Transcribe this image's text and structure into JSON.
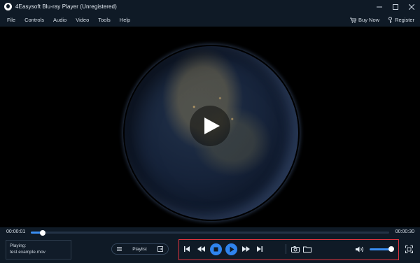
{
  "window": {
    "title": "4Easysoft Blu-ray Player (Unregistered)"
  },
  "menu": {
    "items": [
      {
        "label": "File"
      },
      {
        "label": "Controls"
      },
      {
        "label": "Audio"
      },
      {
        "label": "Video"
      },
      {
        "label": "Tools"
      },
      {
        "label": "Help"
      }
    ],
    "buy_now": "Buy Now",
    "register": "Register"
  },
  "player": {
    "current_time": "00:00:01",
    "total_time": "00:00:30",
    "progress": 0.033,
    "volume": 1.0,
    "now_playing_label": "Playing:",
    "now_playing_file": "test example.mov",
    "playlist_label": "Playlist"
  },
  "colors": {
    "accent": "#3a8ef2",
    "highlight": "#e0353e",
    "bar_background": "#0f1a26"
  },
  "icons": [
    "app-logo-icon",
    "minimize-icon",
    "maximize-icon",
    "close-icon",
    "cart-icon",
    "key-icon",
    "play-icon",
    "previous-icon",
    "rewind-icon",
    "stop-icon",
    "forward-icon",
    "next-icon",
    "snapshot-icon",
    "folder-icon",
    "volume-icon",
    "fullscreen-icon",
    "playlist-menu-icon",
    "playlist-toggle-icon"
  ]
}
